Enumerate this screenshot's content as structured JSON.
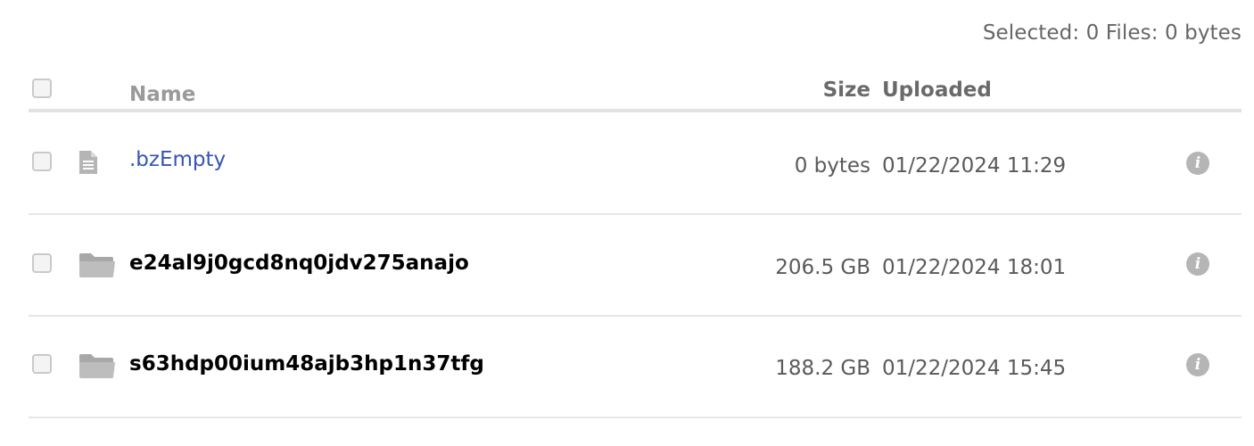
{
  "selection": {
    "summary": "Selected: 0 Files: 0 bytes"
  },
  "columns": {
    "name": "Name",
    "size": "Size",
    "uploaded": "Uploaded"
  },
  "rows": [
    {
      "type": "file",
      "icon": "file-icon",
      "name": ".bzEmpty",
      "size": "0 bytes",
      "uploaded": "01/22/2024 11:29",
      "checked": false
    },
    {
      "type": "folder",
      "icon": "folder-icon",
      "name": "e24al9j0gcd8nq0jdv275anajo",
      "size": "206.5 GB",
      "uploaded": "01/22/2024 18:01",
      "checked": false
    },
    {
      "type": "folder",
      "icon": "folder-icon",
      "name": "s63hdp00ium48ajb3hp1n37tfg",
      "size": "188.2 GB",
      "uploaded": "01/22/2024 15:45",
      "checked": false
    }
  ],
  "icons": {
    "info": "i"
  },
  "colors": {
    "file_link": "#3554b5",
    "icon_gray": "#b5b5b5"
  }
}
